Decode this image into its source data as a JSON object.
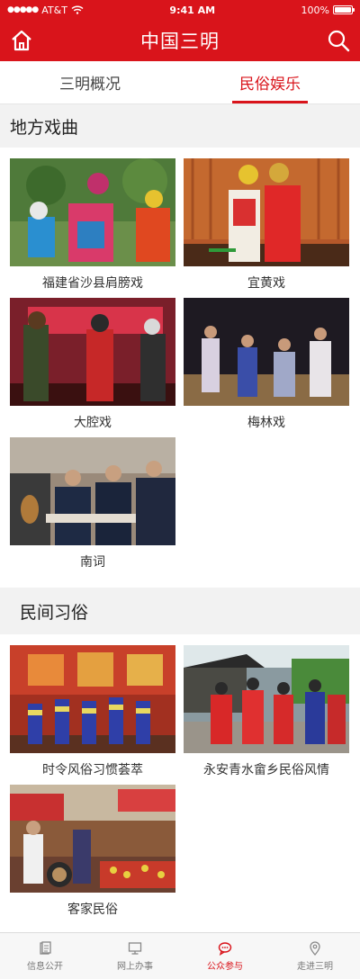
{
  "status_bar": {
    "carrier": "AT&T",
    "time": "9:41 AM",
    "battery": "100%"
  },
  "header": {
    "title": "中国三明",
    "home_icon": "home-icon",
    "search_icon": "search-icon",
    "color": "#d9141b"
  },
  "tabs": [
    {
      "label": "三明概况",
      "active": false
    },
    {
      "label": "民俗娱乐",
      "active": true
    }
  ],
  "sections": [
    {
      "title": "地方戏曲",
      "items": [
        {
          "label": "福建省沙县肩膀戏"
        },
        {
          "label": "宜黄戏"
        },
        {
          "label": "大腔戏"
        },
        {
          "label": "梅林戏"
        },
        {
          "label": "南词"
        }
      ]
    },
    {
      "title": "民间习俗",
      "items": [
        {
          "label": "时令风俗习惯荟萃"
        },
        {
          "label": "永安青水畲乡民俗风情"
        },
        {
          "label": "客家民俗"
        }
      ]
    }
  ],
  "bottom_nav": [
    {
      "label": "信息公开",
      "icon": "document-icon",
      "active": false
    },
    {
      "label": "网上办事",
      "icon": "monitor-icon",
      "active": false
    },
    {
      "label": "公众参与",
      "icon": "chat-icon",
      "active": true
    },
    {
      "label": "走进三明",
      "icon": "location-pin-icon",
      "active": false
    }
  ]
}
